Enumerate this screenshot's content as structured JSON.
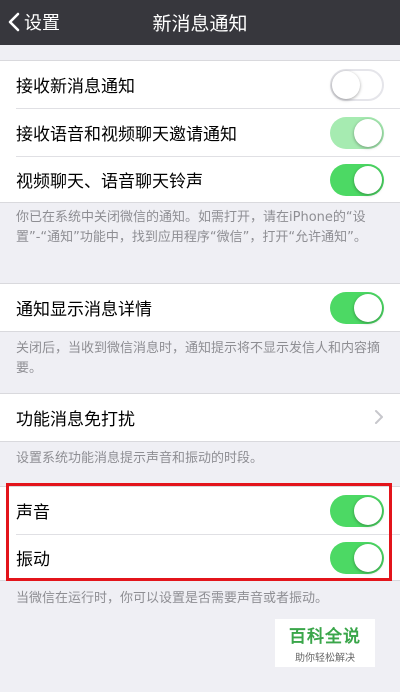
{
  "navbar": {
    "back_label": "设置",
    "title": "新消息通知"
  },
  "group1": {
    "items": [
      {
        "label": "接收新消息通知",
        "toggle": "off"
      },
      {
        "label": "接收语音和视频聊天邀请通知",
        "toggle": "on-disabled"
      },
      {
        "label": "视频聊天、语音聊天铃声",
        "toggle": "on"
      }
    ],
    "note": "你已在系统中关闭微信的通知。如需打开，请在iPhone的“设置”-“通知”功能中，找到应用程序“微信”，打开“允许通知”。"
  },
  "group2": {
    "item": {
      "label": "通知显示消息详情",
      "toggle": "on"
    },
    "note": "关闭后，当收到微信消息时，通知提示将不显示发信人和内容摘要。"
  },
  "group3": {
    "item": {
      "label": "功能消息免打扰"
    },
    "note": "设置系统功能消息提示声音和振动的时段。"
  },
  "group4": {
    "items": [
      {
        "label": "声音",
        "toggle": "on"
      },
      {
        "label": "振动",
        "toggle": "on"
      }
    ],
    "note": "当微信在运行时，你可以设置是否需要声音或者振动。"
  },
  "watermark": {
    "title": "百科全说",
    "subtitle": "助你轻松解决"
  },
  "colors": {
    "navbar": "#37373d",
    "background": "#efeff4",
    "toggle_on": "#4cd964",
    "toggle_on_disabled": "#a6ebb1",
    "highlight": "#e3141b",
    "note_text": "#8e8e93"
  }
}
